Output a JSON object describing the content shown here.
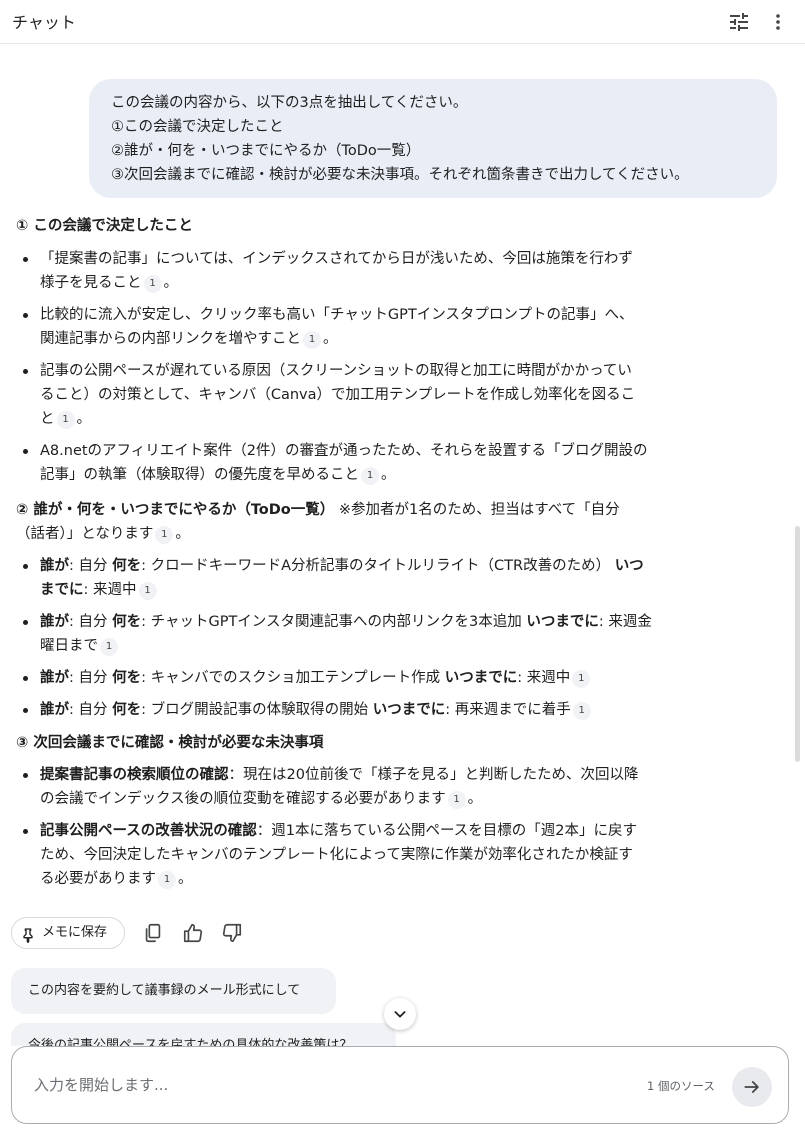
{
  "header": {
    "title": "チャット"
  },
  "user_prompt": {
    "lines": [
      "この会議の内容から、以下の3点を抽出してください。",
      "①この会議で決定したこと",
      "②誰が・何を・いつまでにやるか（ToDo一覧）",
      "③次回会議までに確認・検討が必要な未決事項。それぞれ箇条書きで出力してください。"
    ]
  },
  "answer": {
    "section1": {
      "heading": "① この会議で決定したこと",
      "items": [
        {
          "lines": [
            "「提案書の記事」については、インデックスされてから日が浅いため、今回は施策を行わず",
            "様子を見ること"
          ],
          "cite": "1",
          "end": "。"
        },
        {
          "lines": [
            "比較的に流入が安定し、クリック率も高い「チャットGPTインスタプロンプトの記事」へ、",
            "関連記事からの内部リンクを増やすこと"
          ],
          "cite": "1",
          "end": "。"
        },
        {
          "lines": [
            "記事の公開ペースが遅れている原因（スクリーンショットの取得と加工に時間がかかってい",
            "ること）の対策として、キャンバ（Canva）で加工用テンプレートを作成し効率化を図るこ",
            "と"
          ],
          "cite": "1",
          "end": "。"
        },
        {
          "lines": [
            "A8.netのアフィリエイト案件（2件）の審査が通ったため、それらを設置する「ブログ開設の",
            "記事」の執筆（体験取得）の優先度を早めること"
          ],
          "cite": "1",
          "end": "。"
        }
      ]
    },
    "section2": {
      "heading": "② 誰が・何を・いつまでにやるか（ToDo一覧）",
      "note_line1": "※参加者が1名のため、担当はすべて「自分",
      "note_line2": "（話者）」となります",
      "note_cite": "1",
      "note_end": "。",
      "label_who": "誰が",
      "label_what": "何を",
      "label_when": "いつまでに",
      "todos": [
        {
          "who": ": 自分 ",
          "what": ": クロードキーワードA分析記事のタイトルリライト（CTR改善のため） ",
          "when": "いつ",
          "when2": "までに",
          "deadline": ": 来週中",
          "cite": "1"
        },
        {
          "who": ": 自分 ",
          "what": ": チャットGPTインスタ関連記事への内部リンクを3本追加 ",
          "when": "いつまでに",
          "deadline": ": 来週金",
          "deadline2": "曜日まで",
          "cite": "1"
        },
        {
          "who": ": 自分 ",
          "what": ": キャンバでのスクショ加工テンプレート作成 ",
          "when": "いつまでに",
          "deadline": ": 来週中",
          "cite": "1"
        },
        {
          "who": ": 自分 ",
          "what": ": ブログ開設記事の体験取得の開始 ",
          "when": "いつまでに",
          "deadline": ": 再来週までに着手",
          "cite": "1"
        }
      ]
    },
    "section3": {
      "heading": "③ 次回会議までに確認・検討が必要な未決事項",
      "items": [
        {
          "title": "提案書記事の検索順位の確認",
          "lines": [
            "：現在は20位前後で「様子を見る」と判断したため、次回以降",
            "の会議でインデックス後の順位変動を確認する必要があります"
          ],
          "cite": "1",
          "end": "。"
        },
        {
          "title": "記事公開ペースの改善状況の確認",
          "lines": [
            "：週1本に落ちている公開ペースを目標の「週2本」に戻す",
            "ため、今回決定したキャンバのテンプレート化によって実際に作業が効率化されたか検証す",
            "る必要があります"
          ],
          "cite": "1",
          "end": "。"
        }
      ]
    }
  },
  "actions": {
    "save_label": "メモに保存"
  },
  "suggestions": [
    "この内容を要約して議事録のメール形式にして",
    "今後の記事公開ペースを戻すための具体的な改善策は？"
  ],
  "composer": {
    "placeholder": "入力を開始します...",
    "source_count": "1 個のソース"
  },
  "icons": {
    "tune": "tune-icon",
    "more": "more-vert-icon",
    "pin": "pin-icon",
    "copy": "copy-icon",
    "thumb_up": "thumb-up-icon",
    "thumb_down": "thumb-down-icon",
    "chevron": "chevron-down-icon",
    "send": "arrow-right-icon"
  }
}
